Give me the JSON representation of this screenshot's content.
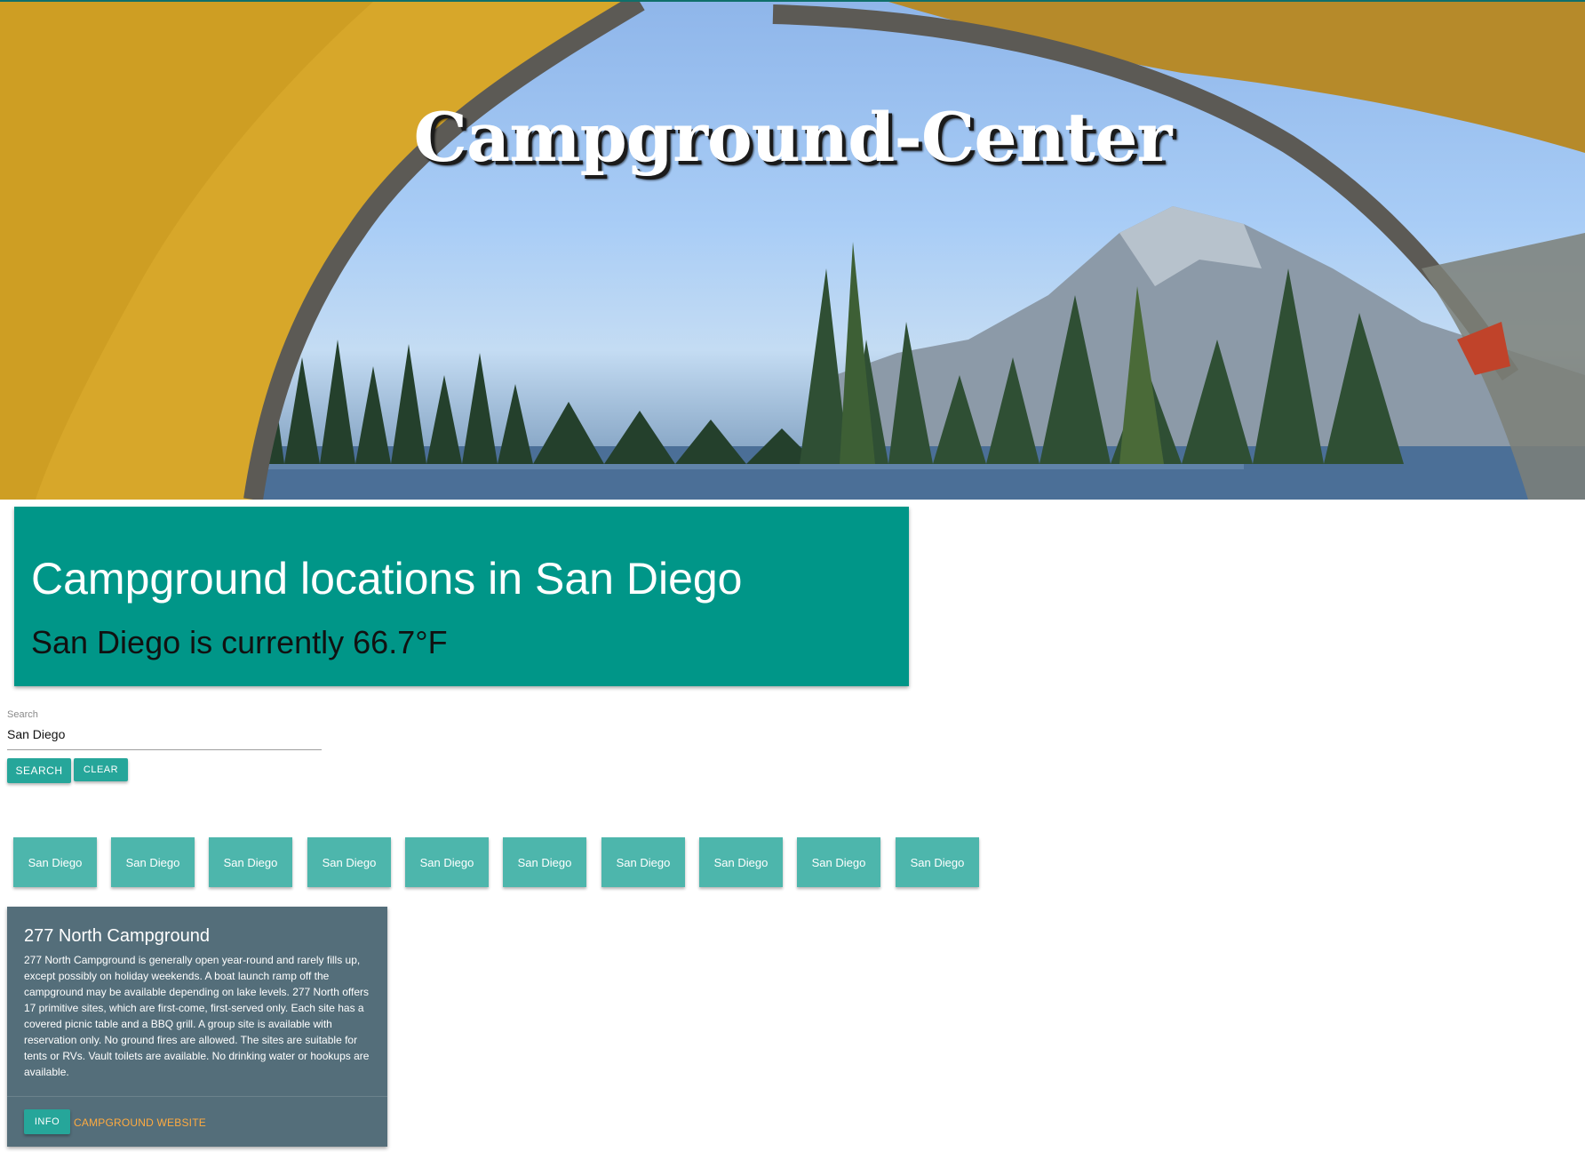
{
  "hero": {
    "title": "Campground-Center"
  },
  "info_panel": {
    "heading": "Campground locations in San Diego",
    "weather": "San Diego is currently 66.7°F",
    "color": "#009688"
  },
  "search": {
    "label": "Search",
    "value": "San Diego",
    "search_button": "SEARCH",
    "clear_button": "CLEAR"
  },
  "history": [
    "San Diego",
    "San Diego",
    "San Diego",
    "San Diego",
    "San Diego",
    "San Diego",
    "San Diego",
    "San Diego",
    "San Diego",
    "San Diego"
  ],
  "card": {
    "title": "277 North Campground",
    "description": "277 North Campground is generally open year-round and rarely fills up, except possibly on holiday weekends. A boat launch ramp off the campground may be available depending on lake levels. 277 North offers 17 primitive sites, which are first-come, first-served only. Each site has a covered picnic table and a BBQ grill. A group site is available with reservation only. No ground fires are allowed. The sites are suitable for tents or RVs. Vault toilets are available. No drinking water or hookups are available.",
    "info_button": "INFO",
    "website_link": "CAMPGROUND WEBSITE",
    "color": "#546e7a",
    "link_color": "#ffab40"
  }
}
